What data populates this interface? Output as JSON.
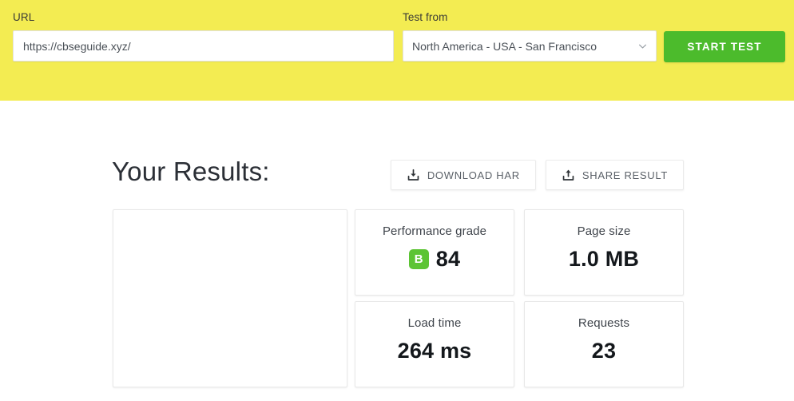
{
  "testbar": {
    "url_label": "URL",
    "url_value": "https://cbseguide.xyz/",
    "url_placeholder": "Enter a URL to test",
    "location_label": "Test from",
    "location_value": "North America - USA - San Francisco",
    "start_button": "START TEST",
    "background_color": "#f3ec52",
    "button_color": "#4cbb2c"
  },
  "results": {
    "title": "Your Results:",
    "download_har_label": "DOWNLOAD HAR",
    "share_result_label": "SHARE RESULT",
    "metrics": [
      {
        "label": "Performance grade",
        "grade": "B",
        "value": "84",
        "grade_color": "#5cc434"
      },
      {
        "label": "Page size",
        "value": "1.0 MB"
      },
      {
        "label": "Load time",
        "value": "264 ms"
      },
      {
        "label": "Requests",
        "value": "23"
      }
    ]
  }
}
